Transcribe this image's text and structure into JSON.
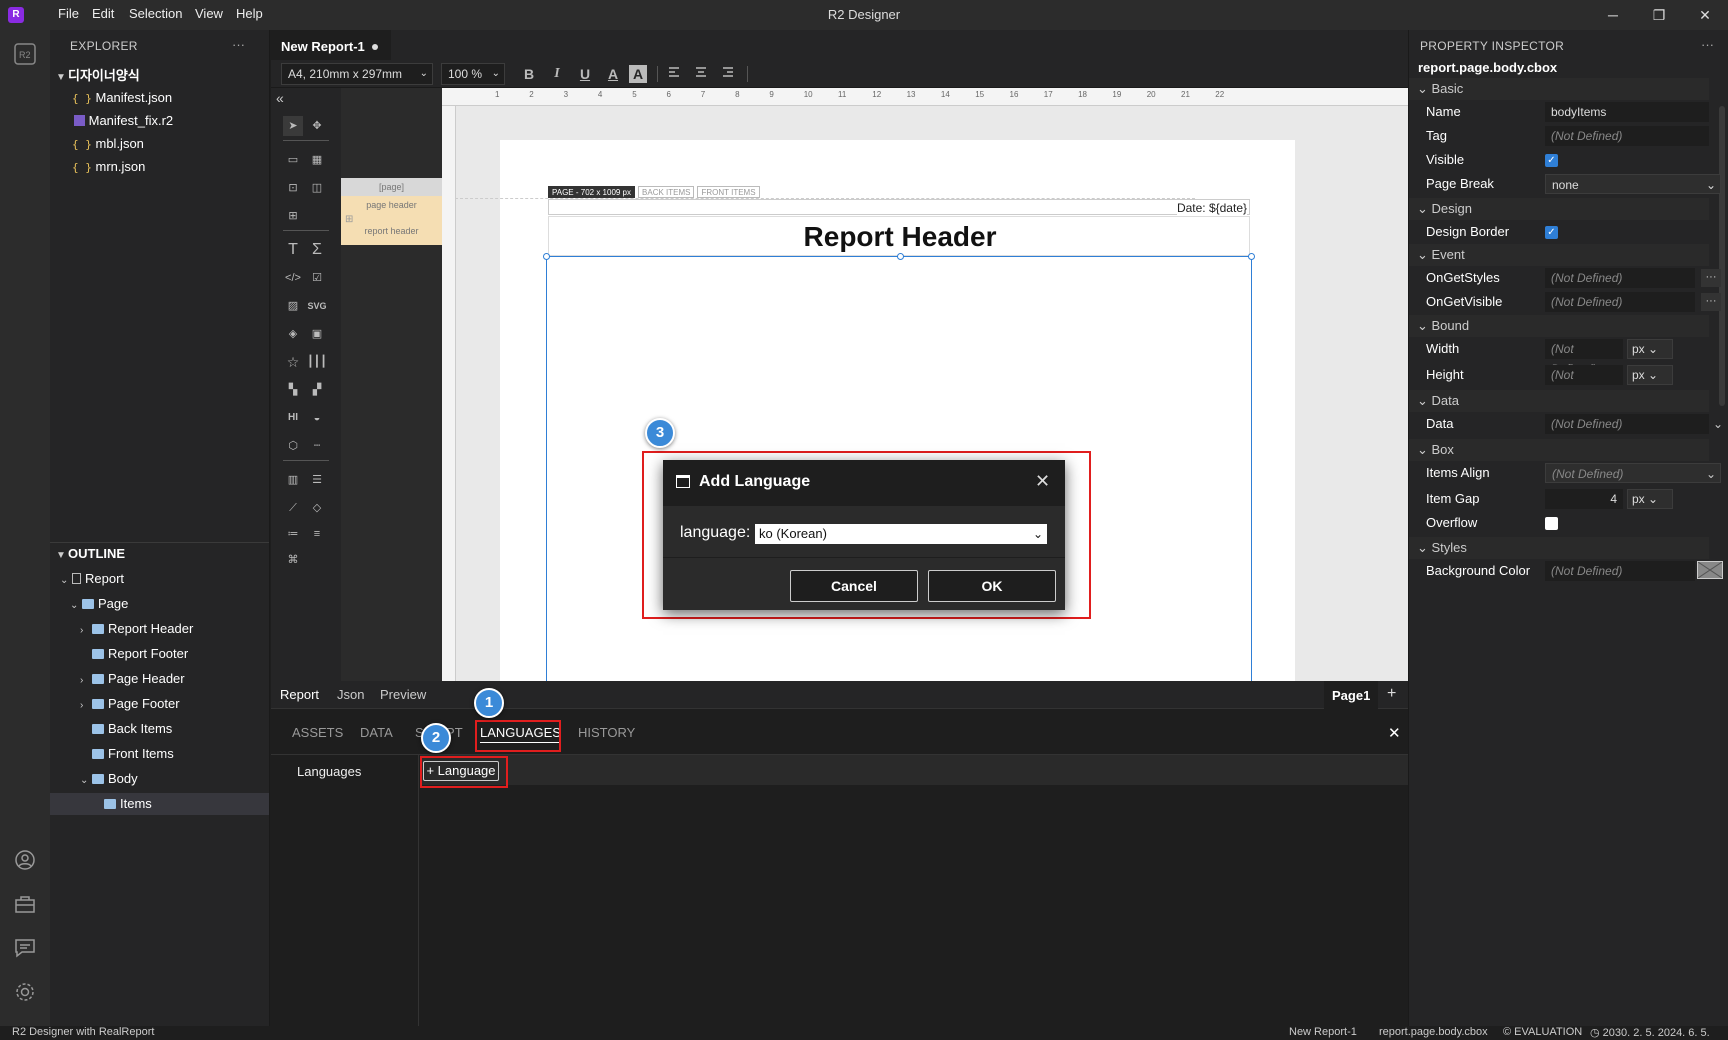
{
  "window": {
    "title": "R2 Designer",
    "logo": "R",
    "menu": [
      "File",
      "Edit",
      "Selection",
      "View",
      "Help"
    ],
    "controls": {
      "minimize": "─",
      "restore": "❐",
      "close": "✕"
    }
  },
  "explorer": {
    "title": "EXPLORER",
    "more": "···",
    "root": "디자이너양식",
    "files": [
      "Manifest.json",
      "Manifest_fix.r2",
      "mbl.json",
      "mrn.json"
    ],
    "json_icon": "{ }"
  },
  "outline": {
    "title": "OUTLINE",
    "items": [
      "Report",
      "Page",
      "Report Header",
      "Report Footer",
      "Page Header",
      "Page Footer",
      "Back Items",
      "Front Items",
      "Body",
      "Items"
    ]
  },
  "editor": {
    "tab_title": "New Report-1",
    "page_size": "A4, 210mm x 297mm",
    "zoom": "100",
    "zoom_unit": "%",
    "format_buttons": [
      "B",
      "I",
      "U",
      "A",
      "A"
    ],
    "ruler_numbers": [
      "1",
      "2",
      "3",
      "4",
      "5",
      "6",
      "7",
      "8",
      "9",
      "10",
      "11",
      "12",
      "13",
      "14",
      "15",
      "16",
      "17",
      "18",
      "19",
      "20",
      "21",
      "22"
    ],
    "band_list": {
      "page": "[page]",
      "page_header": "page header",
      "report_header": "report header"
    },
    "page_tabs": {
      "page_info": "PAGE - 702 x 1009 px",
      "back_items": "BACK ITEMS",
      "front_items": "FRONT ITEMS"
    },
    "date_text": "Date: ${date}",
    "report_header_text": "Report Header",
    "view_tabs": [
      "Report",
      "Json",
      "Preview"
    ],
    "page_tab": "Page1",
    "add_page": "+"
  },
  "bottom_panel": {
    "tabs": [
      "ASSETS",
      "DATA",
      "SCRIPT",
      "LANGUAGES",
      "HISTORY"
    ],
    "active_tab": "LANGUAGES",
    "close": "✕",
    "sidebar_label": "Languages",
    "add_language_button": "+ Language"
  },
  "dialog": {
    "title": "Add Language",
    "close": "✕",
    "field_label": "language:",
    "selected": "ko (Korean)",
    "cancel": "Cancel",
    "ok": "OK"
  },
  "callouts": [
    "1",
    "2",
    "3"
  ],
  "inspector": {
    "title": "PROPERTY INSPECTOR",
    "more": "···",
    "path": "report.page.body.cbox",
    "sections": {
      "basic": "Basic",
      "design": "Design",
      "event": "Event",
      "bound": "Bound",
      "data": "Data",
      "box": "Box",
      "styles": "Styles"
    },
    "props": {
      "name_label": "Name",
      "name_value": "bodyItems",
      "tag_label": "Tag",
      "visible_label": "Visible",
      "page_break_label": "Page Break",
      "page_break_value": "none",
      "design_border_label": "Design Border",
      "on_get_styles_label": "OnGetStyles",
      "on_get_visible_label": "OnGetVisible",
      "width_label": "Width",
      "height_label": "Height",
      "unit": "px",
      "data_label": "Data",
      "items_align_label": "Items Align",
      "item_gap_label": "Item Gap",
      "item_gap_value": "4",
      "overflow_label": "Overflow",
      "background_color_label": "Background Color",
      "not_defined": "(Not Defined)",
      "dots": "···"
    }
  },
  "status": {
    "left": "R2 Designer with RealReport",
    "report": "New Report-1",
    "path": "report.page.body.cbox",
    "evaluation": "EVALUATION",
    "dates": "2030. 2. 5.    2024. 6. 5."
  },
  "colors": {
    "accent": "#3b8ad8",
    "highlight": "#e01e1e",
    "band_fill": "#f5deb3"
  }
}
